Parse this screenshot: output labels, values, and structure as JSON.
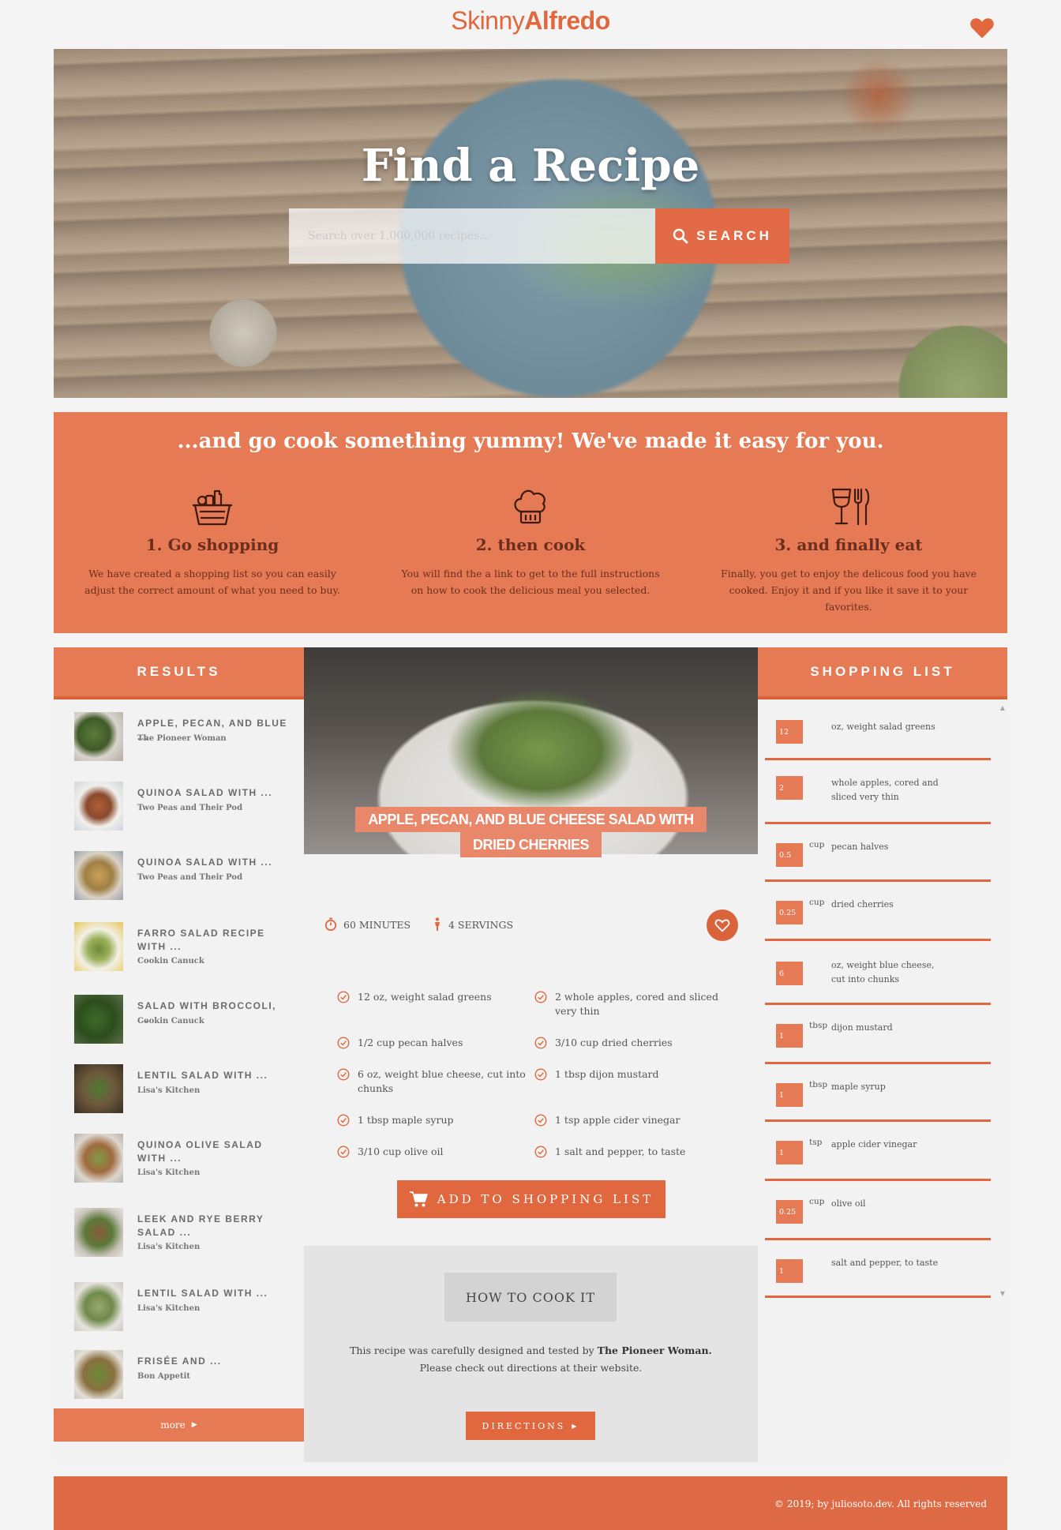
{
  "brand": {
    "name_light": "Skinny",
    "name_bold": "Alfredo"
  },
  "hero": {
    "title": "Find a Recipe",
    "search_placeholder": "Search over 1,000,000 recipes...",
    "search_button": "SEARCH"
  },
  "steps": {
    "title": "...and go cook something yummy! We've made it easy for you.",
    "items": [
      {
        "icon": "shopping-basket-icon",
        "title": "1. Go shopping",
        "text": "We have created a shopping list so you can easily adjust the correct amount of what you need to buy."
      },
      {
        "icon": "chef-hat-icon",
        "title": "2. then cook",
        "text": "You will find the a link to get to the full instructions on how to cook the delicious meal you selected."
      },
      {
        "icon": "wine-glass-fork-icon",
        "title": "3. and finally eat",
        "text": "Finally, you get to enjoy the delicous food you have cooked. Enjoy it and if you like it save it to your favorites."
      }
    ]
  },
  "results": {
    "header": "RESULTS",
    "items": [
      {
        "title": "APPLE, PECAN, AND BLUE ...",
        "source": "The Pioneer Woman"
      },
      {
        "title": "QUINOA SALAD WITH ...",
        "source": "Two Peas and Their Pod"
      },
      {
        "title": "QUINOA SALAD WITH ...",
        "source": "Two Peas and Their Pod"
      },
      {
        "title": "FARRO SALAD RECIPE WITH ...",
        "source": "Cookin Canuck"
      },
      {
        "title": "SALAD WITH BROCCOLI, ...",
        "source": "Cookin Canuck"
      },
      {
        "title": "LENTIL SALAD WITH ...",
        "source": "Lisa's Kitchen"
      },
      {
        "title": "QUINOA OLIVE SALAD WITH ...",
        "source": "Lisa's Kitchen"
      },
      {
        "title": "LEEK AND RYE BERRY SALAD ...",
        "source": "Lisa's Kitchen"
      },
      {
        "title": "LENTIL SALAD WITH ...",
        "source": "Lisa's Kitchen"
      },
      {
        "title": "FRISÉE AND ...",
        "source": "Bon Appetit"
      }
    ],
    "more_label": "more"
  },
  "recipe": {
    "title_line1": "APPLE, PECAN, AND BLUE CHEESE SALAD WITH",
    "title_line2": "DRIED CHERRIES",
    "time": "60 MINUTES",
    "servings": "4 SERVINGS",
    "ingredients": [
      "12 oz, weight salad greens",
      "2 whole apples, cored and sliced very thin",
      "1/2 cup pecan halves",
      "3/10 cup dried cherries",
      "6 oz, weight blue cheese, cut into chunks",
      "1 tbsp dijon mustard",
      "1 tbsp maple syrup",
      "1 tsp apple cider vinegar",
      "3/10 cup olive oil",
      "1 salt and pepper, to taste"
    ],
    "add_button": "ADD TO SHOPPING LIST",
    "how_title": "HOW TO COOK IT",
    "how_text_pre": "This recipe was carefully designed and tested by ",
    "how_publisher": "The Pioneer Woman.",
    "how_text_line2": "Please check out directions at their website.",
    "directions_button": "DIRECTIONS"
  },
  "shopping_list": {
    "header": "SHOPPING LIST",
    "items": [
      {
        "qty": "12",
        "unit": "",
        "name": "oz, weight salad greens"
      },
      {
        "qty": "2",
        "unit": "",
        "name": "whole apples, cored and sliced very thin"
      },
      {
        "qty": "0.5",
        "unit": "cup",
        "name": "pecan halves"
      },
      {
        "qty": "0.25",
        "unit": "cup",
        "name": "dried cherries"
      },
      {
        "qty": "6",
        "unit": "",
        "name": "oz, weight blue cheese, cut into chunks"
      },
      {
        "qty": "1",
        "unit": "tbsp",
        "name": "dijon mustard"
      },
      {
        "qty": "1",
        "unit": "tbsp",
        "name": "maple syrup"
      },
      {
        "qty": "1",
        "unit": "tsp",
        "name": "apple cider vinegar"
      },
      {
        "qty": "0.25",
        "unit": "cup",
        "name": "olive oil"
      },
      {
        "qty": "1",
        "unit": "",
        "name": "salt and pepper, to taste"
      }
    ]
  },
  "footer": {
    "text": "© 2019; by juliosoto.dev. All rights reserved"
  },
  "colors": {
    "accent": "#e67a54",
    "accent_dark": "#e0673e",
    "step_text": "#6b2e1e"
  }
}
